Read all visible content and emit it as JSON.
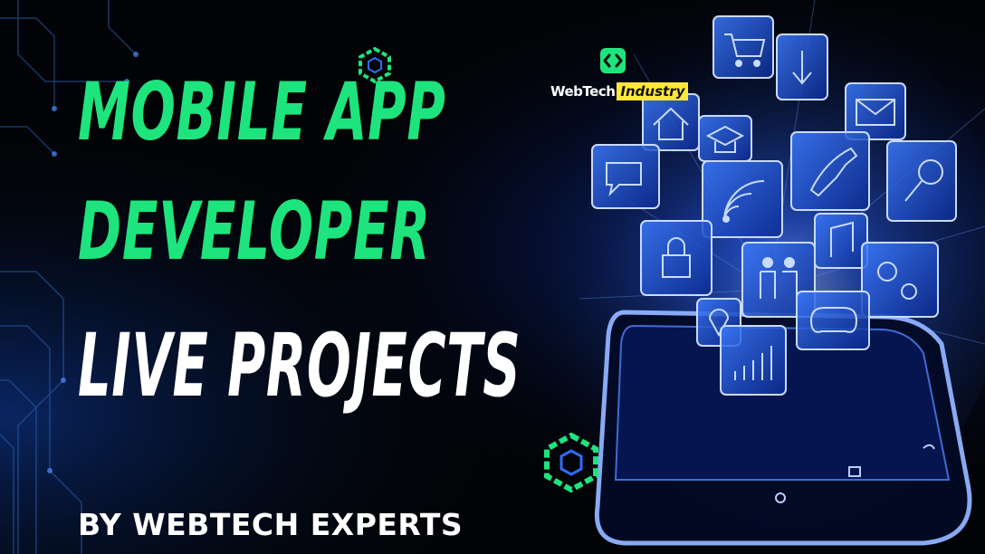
{
  "headline": {
    "line1": "MOBILE APP",
    "line2": "DEVELOPER",
    "line3": "LIVE PROJECTS"
  },
  "byline": "BY WEBTECH EXPERTS",
  "logo": {
    "word1": "WebTech",
    "word2": "Industry"
  },
  "colors": {
    "headline_green": "#1ee47d",
    "text_white": "#ffffff",
    "neon_blue": "#2e6bff",
    "logo_yellow": "#ffe83a",
    "background": "#020306"
  },
  "icons": [
    "shopping-cart-icon",
    "download-icon",
    "home-icon",
    "mail-icon",
    "chat-icon",
    "graduation-cap-icon",
    "wifi-icon",
    "phone-icon",
    "search-icon",
    "lock-icon",
    "people-icon",
    "music-icon",
    "settings-icon",
    "location-icon",
    "gamepad-icon",
    "chart-icon"
  ]
}
